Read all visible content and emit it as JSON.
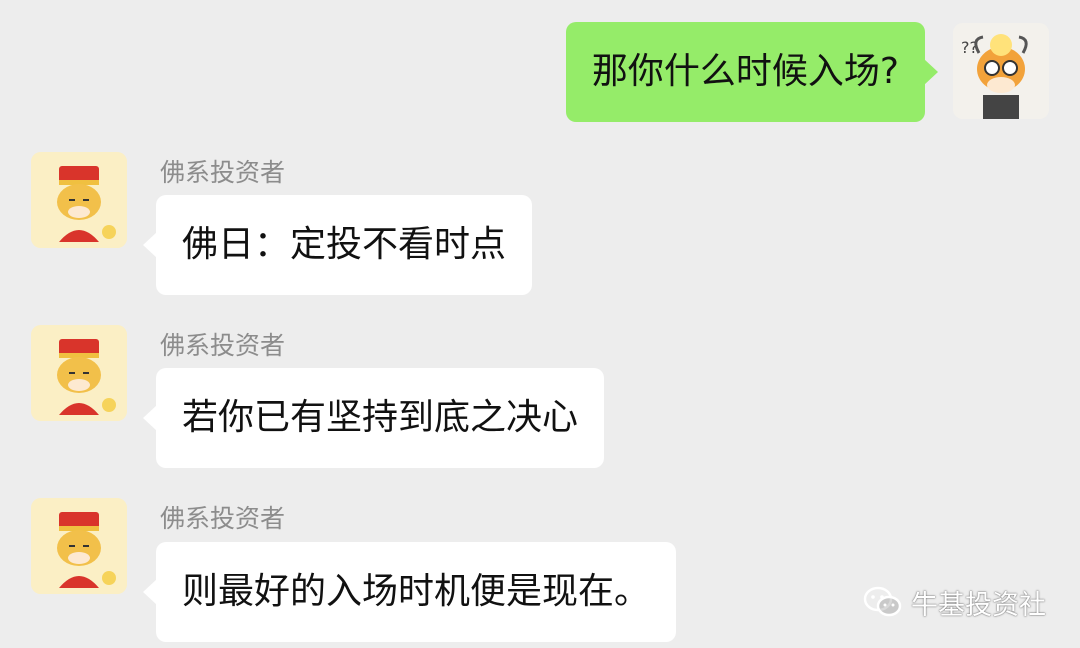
{
  "messages": [
    {
      "direction": "outgoing",
      "text": "那你什么时候入场?"
    },
    {
      "direction": "incoming",
      "sender": "佛系投资者",
      "text": "佛日：定投不看时点"
    },
    {
      "direction": "incoming",
      "sender": "佛系投资者",
      "text": "若你已有坚持到底之决心"
    },
    {
      "direction": "incoming",
      "sender": "佛系投资者",
      "text": "则最好的入场时机便是现在。"
    }
  ],
  "watermark": {
    "text": "牛基投资社",
    "icon": "wechat-icon"
  },
  "colors": {
    "background": "#ededed",
    "outgoing_bubble": "#95ec69",
    "incoming_bubble": "#ffffff",
    "sender_name": "#8c8c8c"
  }
}
